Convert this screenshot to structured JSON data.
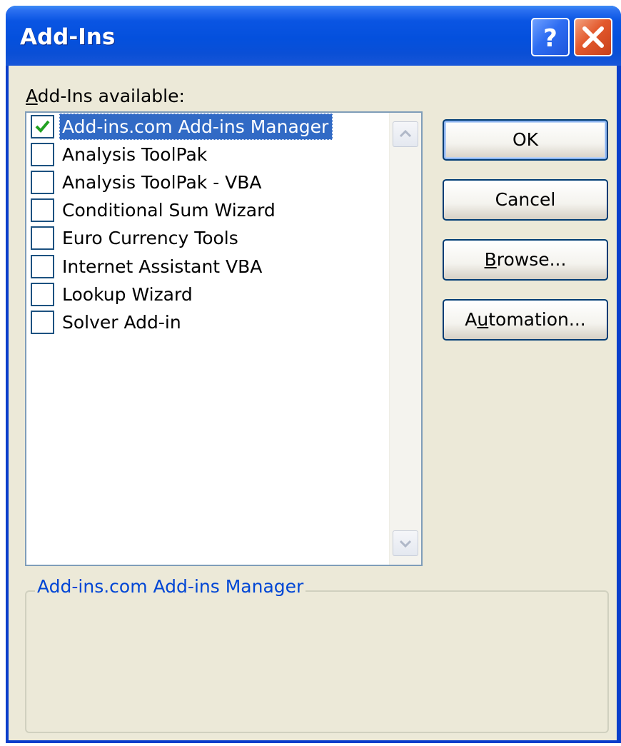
{
  "window": {
    "title": "Add-Ins",
    "help_button_label": "?",
    "close_button_label": "X"
  },
  "list": {
    "label_first": "A",
    "label_rest": "dd-Ins available:",
    "items": [
      {
        "label": "Add-ins.com Add-ins Manager",
        "checked": true,
        "selected": true
      },
      {
        "label": "Analysis ToolPak",
        "checked": false,
        "selected": false
      },
      {
        "label": "Analysis ToolPak - VBA",
        "checked": false,
        "selected": false
      },
      {
        "label": "Conditional Sum Wizard",
        "checked": false,
        "selected": false
      },
      {
        "label": "Euro Currency Tools",
        "checked": false,
        "selected": false
      },
      {
        "label": "Internet Assistant VBA",
        "checked": false,
        "selected": false
      },
      {
        "label": "Lookup Wizard",
        "checked": false,
        "selected": false
      },
      {
        "label": "Solver Add-in",
        "checked": false,
        "selected": false
      }
    ]
  },
  "buttons": {
    "ok": "OK",
    "cancel": "Cancel",
    "browse_first": "B",
    "browse_rest": "rowse...",
    "automation_first": "A",
    "automation_u": "u",
    "automation_rest": "tomation..."
  },
  "description": {
    "group_label": "Add-ins.com Add-ins Manager",
    "text": ""
  },
  "colors": {
    "selection": "#316ac5",
    "check": "#21a121",
    "group_label": "#0046d5",
    "dialog_bg": "#ece9d8"
  }
}
